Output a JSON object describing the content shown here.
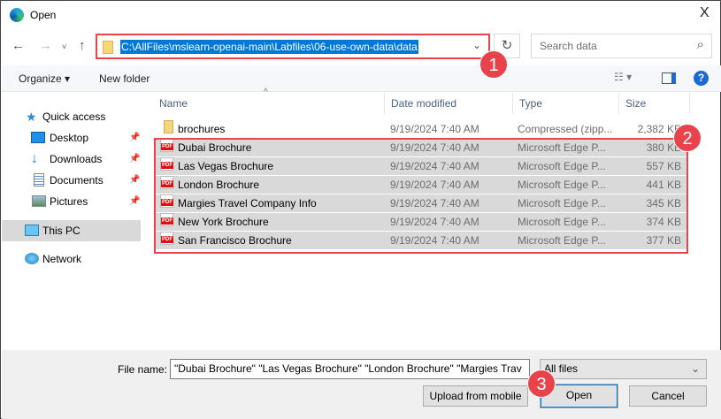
{
  "window": {
    "title": "Open",
    "close": "X"
  },
  "address": {
    "path": "C:\\AllFiles\\mslearn-openai-main\\Labfiles\\06-use-own-data\\data",
    "search_placeholder": "Search data"
  },
  "toolbar": {
    "organize": "Organize ▾",
    "new_folder": "New folder",
    "help": "?"
  },
  "sidebar": {
    "items": [
      {
        "label": "Quick access",
        "icon": "star-icon"
      },
      {
        "label": "Desktop",
        "icon": "desktop-icon",
        "pinned": true
      },
      {
        "label": "Downloads",
        "icon": "download-icon",
        "pinned": true
      },
      {
        "label": "Documents",
        "icon": "documents-icon",
        "pinned": true
      },
      {
        "label": "Pictures",
        "icon": "pictures-icon",
        "pinned": true
      },
      {
        "label": "This PC",
        "icon": "computer-icon",
        "selected": true
      },
      {
        "label": "Network",
        "icon": "network-icon"
      }
    ]
  },
  "columns": {
    "name": "Name",
    "date": "Date modified",
    "type": "Type",
    "size": "Size"
  },
  "files": [
    {
      "name": "brochures",
      "date": "9/19/2024 7:40 AM",
      "type": "Compressed (zipp...",
      "size": "2,382 KB",
      "icon": "zip-folder-icon",
      "selected": false
    },
    {
      "name": "Dubai Brochure",
      "date": "9/19/2024 7:40 AM",
      "type": "Microsoft Edge P...",
      "size": "380 KB",
      "icon": "pdf-icon",
      "selected": true
    },
    {
      "name": "Las Vegas Brochure",
      "date": "9/19/2024 7:40 AM",
      "type": "Microsoft Edge P...",
      "size": "557 KB",
      "icon": "pdf-icon",
      "selected": true
    },
    {
      "name": "London Brochure",
      "date": "9/19/2024 7:40 AM",
      "type": "Microsoft Edge P...",
      "size": "441 KB",
      "icon": "pdf-icon",
      "selected": true
    },
    {
      "name": "Margies Travel Company Info",
      "date": "9/19/2024 7:40 AM",
      "type": "Microsoft Edge P...",
      "size": "345 KB",
      "icon": "pdf-icon",
      "selected": true
    },
    {
      "name": "New York Brochure",
      "date": "9/19/2024 7:40 AM",
      "type": "Microsoft Edge P...",
      "size": "374 KB",
      "icon": "pdf-icon",
      "selected": true
    },
    {
      "name": "San Francisco Brochure",
      "date": "9/19/2024 7:40 AM",
      "type": "Microsoft Edge P...",
      "size": "377 KB",
      "icon": "pdf-icon",
      "selected": true
    }
  ],
  "footer": {
    "file_name_label": "File name:",
    "file_name_value": "\"Dubai Brochure\" \"Las Vegas Brochure\" \"London Brochure\" \"Margies Trav",
    "filter": "All files",
    "upload": "Upload from mobile",
    "open": "Open",
    "cancel": "Cancel"
  },
  "annotations": [
    "1",
    "2",
    "3"
  ],
  "colors": {
    "highlight": "#e8434a",
    "selection": "#0078d7",
    "selected_row": "#d9d9d9"
  }
}
